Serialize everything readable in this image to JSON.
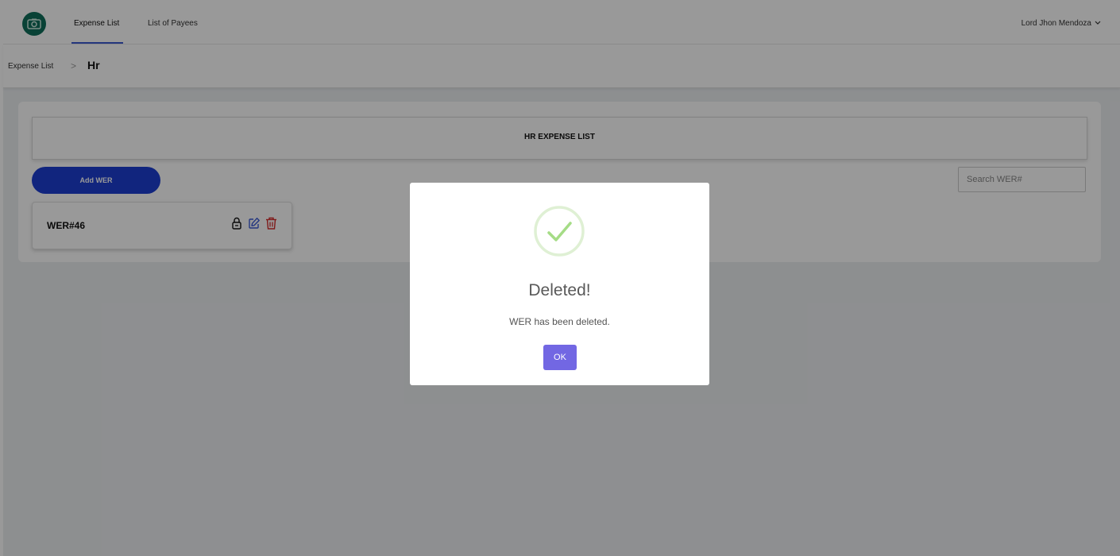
{
  "nav": {
    "logo_icon": "camera-icon",
    "tabs": [
      {
        "label": "Expense List",
        "active": true
      },
      {
        "label": "List of Payees",
        "active": false
      }
    ],
    "user_name": "Lord Jhon Mendoza"
  },
  "breadcrumb": {
    "parent": "Expense List",
    "separator": ">",
    "current": "Hr"
  },
  "main": {
    "title": "HR EXPENSE LIST",
    "add_button_label": "Add WER",
    "search_placeholder": "Search WER#",
    "search_value": "",
    "cards": [
      {
        "label": "WER#46",
        "icons": [
          "lock-icon",
          "edit-icon",
          "trash-icon"
        ]
      }
    ]
  },
  "dialog": {
    "icon": "success-check-icon",
    "title": "Deleted!",
    "message": "WER has been deleted.",
    "ok_label": "OK"
  },
  "colors": {
    "accent_blue": "#1d3fd2",
    "ok_button": "#7267e3",
    "success_green": "#a5dc86",
    "edit_blue": "#3b5bd6",
    "delete_red": "#d62c2c",
    "logo_green": "#0f6e5a"
  }
}
